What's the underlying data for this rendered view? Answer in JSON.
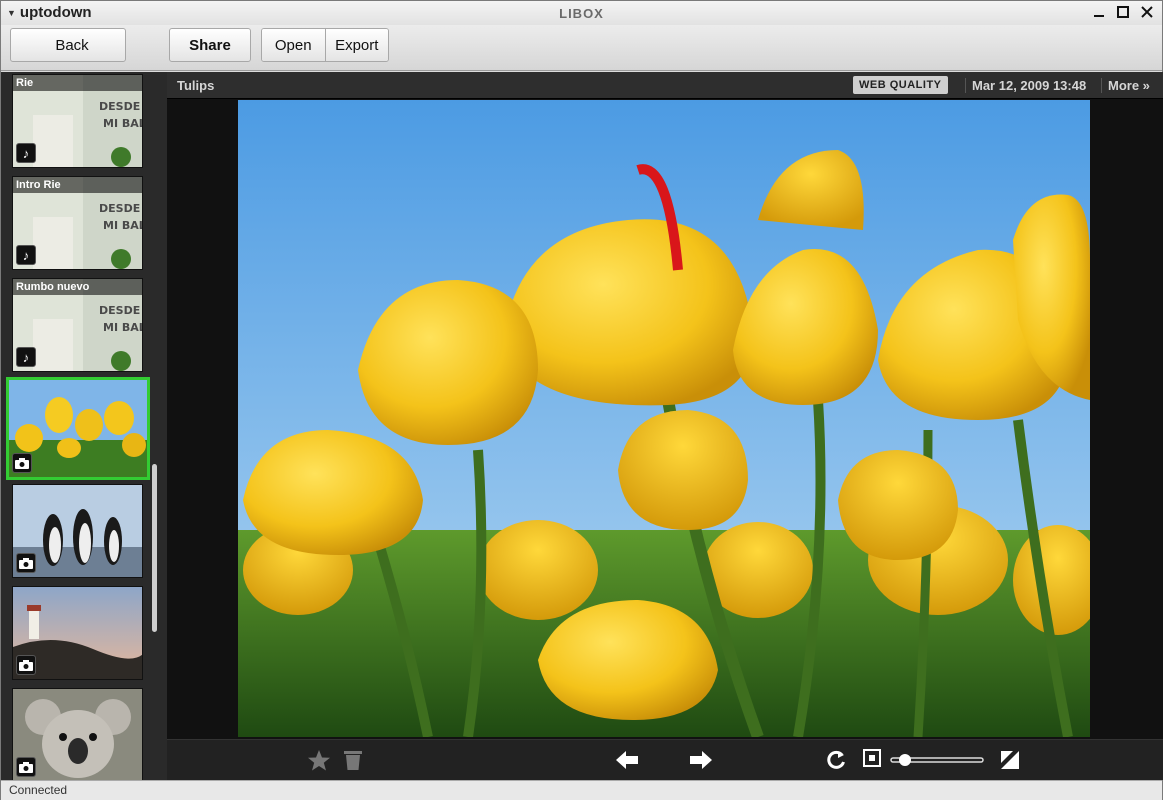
{
  "window": {
    "app_menu_label": "uptodown",
    "title": "LIBOX",
    "icons": [
      "chevron-down-icon",
      "minimize-icon",
      "maximize-icon",
      "close-icon"
    ]
  },
  "toolbar": {
    "back_label": "Back",
    "share_label": "Share",
    "open_label": "Open",
    "export_label": "Export"
  },
  "sidebar": {
    "items": [
      {
        "label": "Rie",
        "type": "music",
        "icon": "music-note-icon"
      },
      {
        "label": "Intro Rie",
        "type": "music",
        "icon": "music-note-icon"
      },
      {
        "label": "Rumbo nuevo",
        "type": "music",
        "icon": "music-note-icon"
      },
      {
        "label": "",
        "type": "photo",
        "icon": "camera-icon",
        "selected": true
      },
      {
        "label": "",
        "type": "photo",
        "icon": "camera-icon"
      },
      {
        "label": "",
        "type": "photo",
        "icon": "camera-icon"
      },
      {
        "label": "",
        "type": "photo",
        "icon": "camera-icon"
      }
    ]
  },
  "viewer": {
    "title": "Tulips",
    "quality_badge": "WEB QUALITY",
    "date": "Mar 12, 2009 13:48",
    "more_label": "More »"
  },
  "bottombar": {
    "icons": [
      "star-icon",
      "trash-icon",
      "arrow-left-icon",
      "arrow-right-icon",
      "rotate-icon",
      "fit-icon",
      "fullscreen-icon"
    ],
    "zoom_level": 0.1
  },
  "status": {
    "text": "Connected"
  },
  "colors": {
    "selection_border": "#33cc33",
    "tulip_yellow": "#f2c319",
    "sky_blue": "#6fb1e8"
  }
}
